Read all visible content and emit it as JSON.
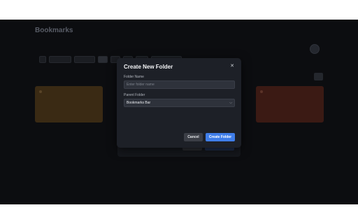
{
  "app": {
    "title": "Bookmarks"
  },
  "colors": {
    "accent": "#3f7de8",
    "modal_bg": "#1d2027",
    "backdrop": "#0c0d10"
  },
  "modal": {
    "title": "Create New Folder",
    "close_icon": "close-icon",
    "folder_name": {
      "label": "Folder Name",
      "placeholder": "Enter folder name",
      "value": ""
    },
    "parent_folder": {
      "label": "Parent Folder",
      "selected": "Bookmarks Bar"
    },
    "cancel_label": "Cancel",
    "create_label": "Create Folder"
  }
}
